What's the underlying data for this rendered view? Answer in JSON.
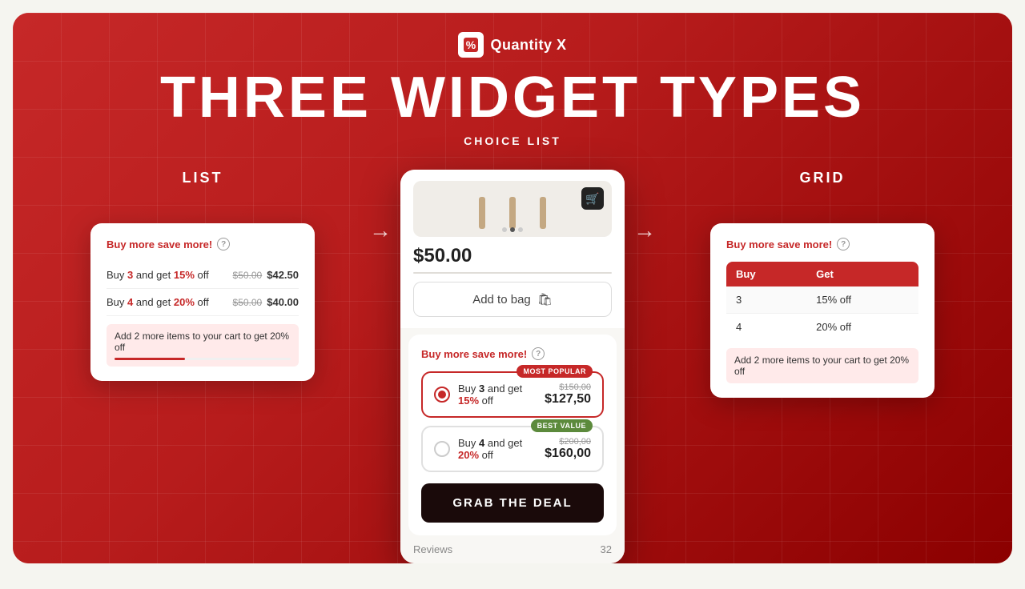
{
  "brand": {
    "logo_symbol": "%/",
    "logo_text": "Quantity X"
  },
  "page": {
    "heading": "THREE WIDGET TYPES",
    "subtitle": "CHOICE LIST"
  },
  "list_widget": {
    "label": "LIST",
    "card": {
      "title": "Buy more save more!",
      "rows": [
        {
          "left": "Buy 3 and get 15% off",
          "old_price": "$50.00",
          "new_price": "$42.50"
        },
        {
          "left": "Buy 4 and get 20% off",
          "old_price": "$50.00",
          "new_price": "$40.00"
        }
      ],
      "upsell": "Add 2 more items to your cart to get 20% off"
    }
  },
  "choice_widget": {
    "label": "CHOICE LIST",
    "phone": {
      "price": "$50.00",
      "add_to_bag": "Add to bag"
    },
    "panel": {
      "title": "Buy more save more!",
      "options": [
        {
          "selected": true,
          "text": "Buy 3 and get 15% off",
          "old_price": "$150,00",
          "new_price": "$127,50",
          "badge": "MOST POPULAR",
          "badge_type": "popular"
        },
        {
          "selected": false,
          "text": "Buy 4 and get 20% off",
          "old_price": "$200,00",
          "new_price": "$160,00",
          "badge": "BEST VALUE",
          "badge_type": "value"
        }
      ],
      "cta": "GRAB THE DEAL"
    },
    "reviews_label": "Reviews",
    "reviews_count": "32"
  },
  "grid_widget": {
    "label": "GRID",
    "card": {
      "title": "Buy more save more!",
      "columns": [
        "Buy",
        "Get"
      ],
      "rows": [
        {
          "buy": "3",
          "get": "15% off"
        },
        {
          "buy": "4",
          "get": "20% off"
        }
      ],
      "upsell": "Add 2 more items to your cart to get 20% off"
    }
  },
  "arrows": {
    "right": "→",
    "curved": "↗"
  }
}
